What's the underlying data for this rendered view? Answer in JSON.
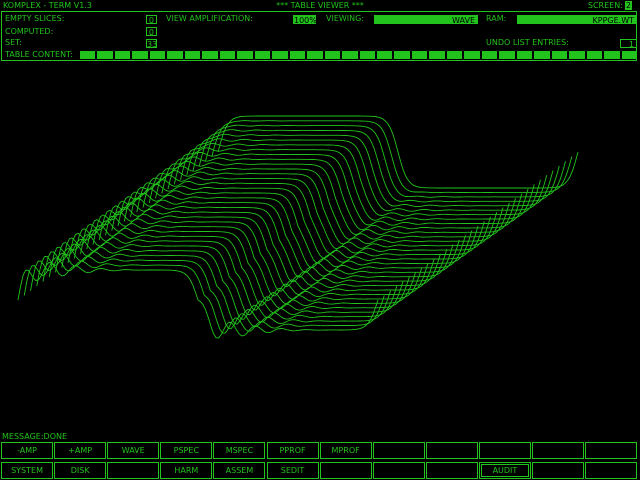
{
  "header": {
    "app_title": "KOMPLEX - TERM V1.3",
    "view_title": "*** TABLE VIEWER ***",
    "screen_label": "SCREEN:",
    "screen_value": "2"
  },
  "info": {
    "empty_slices_label": "EMPTY SLICES:",
    "empty_slices_value": "0",
    "computed_label": "COMPUTED:",
    "computed_value": "0",
    "set_label": "SET:",
    "set_value": "33",
    "view_amp_label": "VIEW AMPLIFICATION:",
    "view_amp_value": "100%",
    "viewing_label": "VIEWING:",
    "viewing_value": "WAVE",
    "ram_label": "RAM:",
    "ram_value": "KPPGE.WT",
    "undo_label": "UNDO LIST ENTRIES:",
    "undo_value": "1",
    "table_content_label": "TABLE CONTENT:",
    "table_content_cells": 32
  },
  "message": "MESSAGE:DONE",
  "buttons_row1": [
    "-AMP",
    "+AMP",
    "WAVE",
    "PSPEC",
    "MSPEC",
    "PPROF",
    "MPROF",
    "",
    "",
    "",
    "",
    ""
  ],
  "buttons_row2": [
    "SYSTEM",
    "DISK",
    "",
    "HARM",
    "ASSEM",
    "SEDIT",
    "",
    "",
    "",
    "AUDIT",
    "",
    ""
  ],
  "colors": {
    "phosphor": "#22c31c",
    "background": "#000000"
  },
  "wavetable": {
    "slices": 33
  }
}
